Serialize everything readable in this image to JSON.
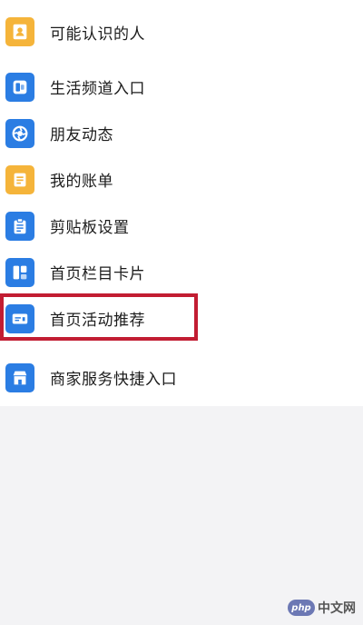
{
  "menu": {
    "items": [
      {
        "label": "可能认识的人",
        "icon": "contact-card-icon",
        "color": "#f5b43a"
      },
      {
        "label": "生活频道入口",
        "icon": "life-channel-icon",
        "color": "#2b7de3"
      },
      {
        "label": "朋友动态",
        "icon": "camera-aperture-icon",
        "color": "#2b7de3"
      },
      {
        "label": "我的账单",
        "icon": "bill-icon",
        "color": "#f5b43a"
      },
      {
        "label": "剪贴板设置",
        "icon": "clipboard-icon",
        "color": "#2b7de3"
      },
      {
        "label": "首页栏目卡片",
        "icon": "column-card-icon",
        "color": "#2b7de3"
      },
      {
        "label": "首页活动推荐",
        "icon": "activity-card-icon",
        "color": "#2b7de3"
      },
      {
        "label": "商家服务快捷入口",
        "icon": "store-icon",
        "color": "#2b7de3"
      }
    ]
  },
  "highlight": {
    "color": "#c21d32",
    "target": "首页活动推荐"
  },
  "watermark": {
    "logo": "php",
    "text": "中文网"
  }
}
